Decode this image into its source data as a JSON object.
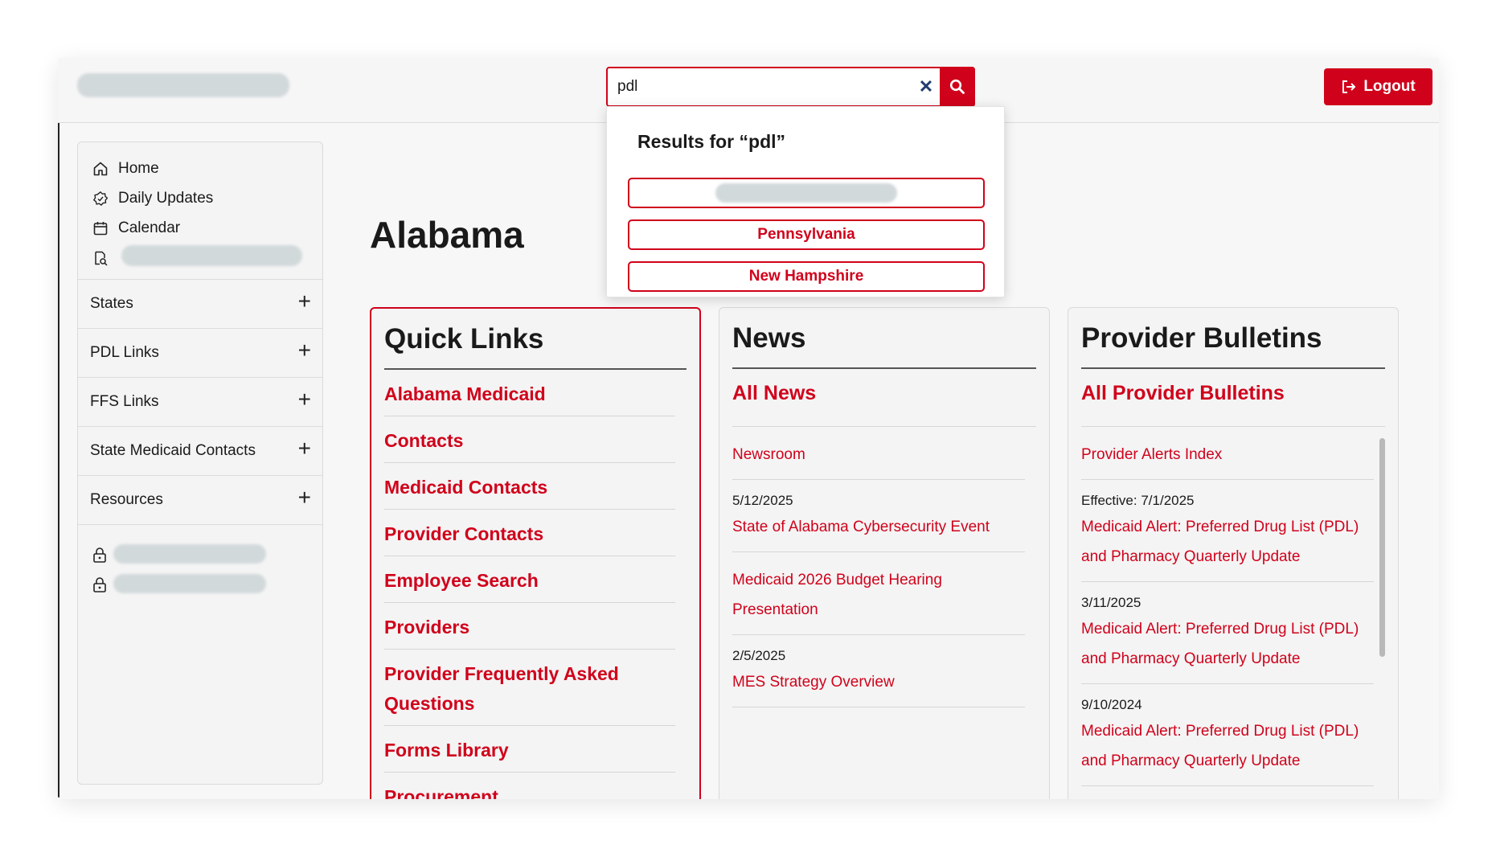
{
  "header": {
    "search_value": "pdl",
    "logout_label": "Logout"
  },
  "search_results": {
    "heading": "Results for “pdl”",
    "items": [
      "",
      "Pennsylvania",
      "New Hampshire"
    ]
  },
  "sidebar": {
    "links": [
      {
        "label": "Home",
        "icon": "home-icon"
      },
      {
        "label": "Daily Updates",
        "icon": "badge-icon"
      },
      {
        "label": "Calendar",
        "icon": "calendar-icon"
      }
    ],
    "sections": [
      "States",
      "PDL Links",
      "FFS Links",
      "State Medicaid Contacts",
      "Resources"
    ]
  },
  "page": {
    "title": "Alabama"
  },
  "quick_links": {
    "title": "Quick Links",
    "items": [
      "Alabama Medicaid",
      "Contacts",
      "Medicaid Contacts",
      "Provider Contacts",
      "Employee Search",
      "Providers",
      "Provider Frequently Asked Questions",
      "Forms Library",
      "Procurement"
    ]
  },
  "news": {
    "title": "News",
    "all_label": "All News",
    "items": [
      {
        "date": "",
        "title": "Newsroom"
      },
      {
        "date": "5/12/2025",
        "title": "State of Alabama Cybersecurity Event"
      },
      {
        "date": "",
        "title": "Medicaid 2026 Budget Hearing Presentation"
      },
      {
        "date": "2/5/2025",
        "title": "MES Strategy Overview"
      }
    ]
  },
  "bulletins": {
    "title": "Provider Bulletins",
    "all_label": "All Provider Bulletins",
    "items": [
      {
        "date": "",
        "title": "Provider Alerts Index"
      },
      {
        "date": "Effective: 7/1/2025",
        "title": "Medicaid Alert: Preferred Drug List (PDL) and Pharmacy Quarterly Update"
      },
      {
        "date": "3/11/2025",
        "title": "Medicaid Alert: Preferred Drug List (PDL) and Pharmacy Quarterly Update"
      },
      {
        "date": "9/10/2024",
        "title": "Medicaid Alert: Preferred Drug List (PDL) and Pharmacy Quarterly Update"
      }
    ]
  },
  "colors": {
    "accent": "#d0021b",
    "clear_icon": "#1f3c70"
  }
}
